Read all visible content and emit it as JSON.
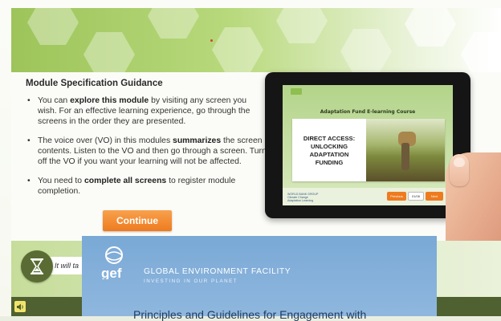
{
  "module": {
    "guidance_title": "Module Specification Guidance",
    "bullets": [
      {
        "pre": "You can ",
        "bold": "explore this module",
        "post": " by visiting any screen you wish. For an effective learning experience, go through the screens in the order they are presented."
      },
      {
        "pre": "The voice over (VO) in this modules ",
        "bold": "summarizes",
        "post": " the screen contents. Listen to the VO and then go through a screen. Turn off the VO if you want your learning will not be affected."
      },
      {
        "pre": "You need to ",
        "bold": "complete all screens",
        "post": " to register module completion."
      }
    ],
    "continue_label": "Continue"
  },
  "tablet": {
    "course_heading": "Adaptation Fund E-learning Course",
    "slide_title": "DIRECT ACCESS: UNLOCKING ADAPTATION FUNDING",
    "footer_logo_text": "WORLD BANK GROUP Climate Change Adaptation Learning",
    "prev_label": "Previous",
    "counter": "01/06",
    "next_label": "Next"
  },
  "bottom": {
    "hint_text": "It will ta",
    "hourglass_icon": "hourglass-icon",
    "audio_icon": "speaker-icon"
  },
  "gef": {
    "logo_text": "gef",
    "org_name": "GLOBAL ENVIRONMENT FACILITY",
    "tagline": "INVESTING IN OUR PLANET",
    "doc_title": "Principles and Guidelines for Engagement with"
  },
  "colors": {
    "accent_orange": "#ee7b1f",
    "brand_green": "#5a6c33",
    "gef_blue": "#7aa9d6"
  }
}
